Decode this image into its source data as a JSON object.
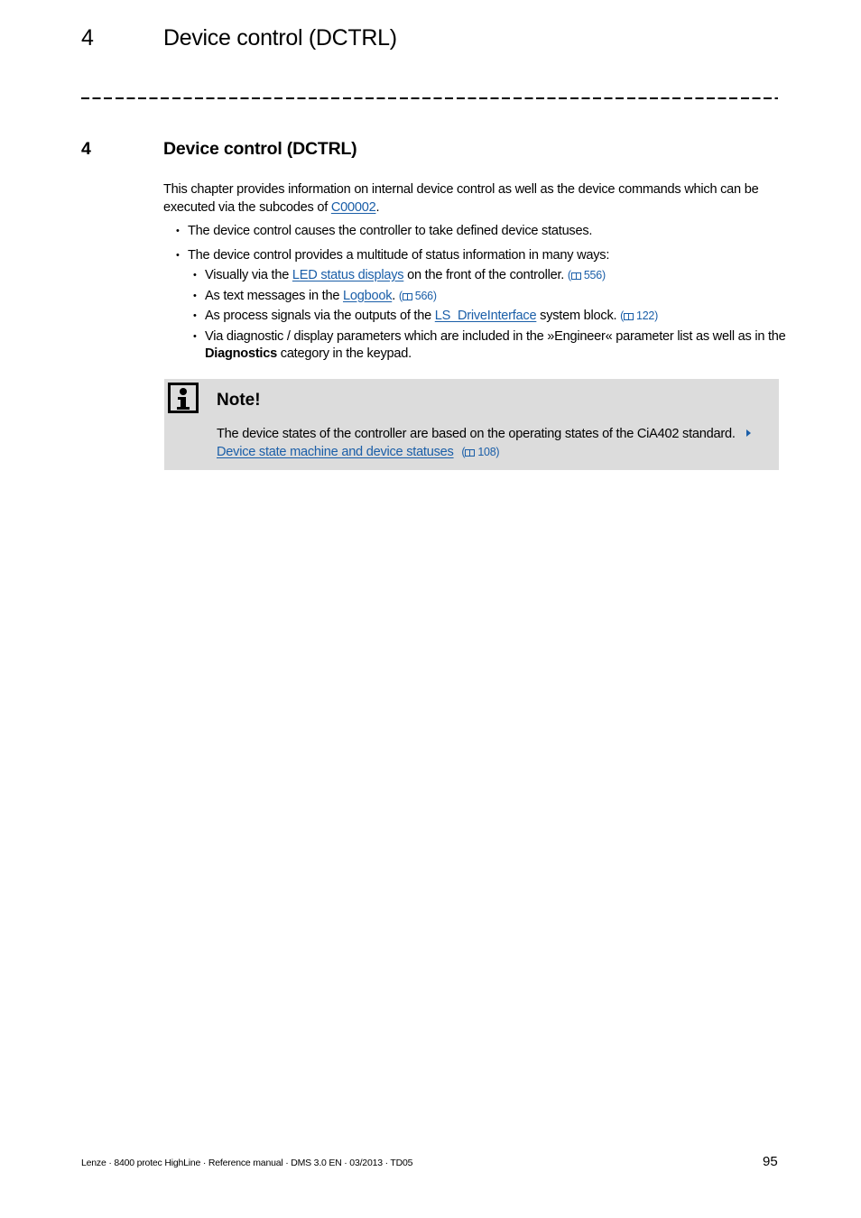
{
  "running_header": {
    "number": "4",
    "title": "Device control (DCTRL)"
  },
  "chapter": {
    "number": "4",
    "title": "Device control (DCTRL)"
  },
  "intro": {
    "text_before": "This chapter provides information on internal device control as well as the device commands which can be executed via the subcodes of ",
    "link": "C00002",
    "text_after": "."
  },
  "bullets": [
    {
      "text": "The device control causes the controller to take defined device statuses."
    },
    {
      "text": "The device control provides a multitude of status information in many ways:"
    }
  ],
  "sub_bullets": [
    {
      "before": "Visually via the ",
      "link": "LED status displays",
      "after": " on the front of the controller. ",
      "ref": "556"
    },
    {
      "before": "As text messages in the ",
      "link": "Logbook",
      "after": ". ",
      "ref": "566"
    },
    {
      "before": "As process signals via the outputs of the ",
      "link": "LS_DriveInterface",
      "after": " system block. ",
      "ref": "122"
    },
    {
      "before": "Via diagnostic / display parameters which are included in the »Engineer« parameter list as well as in the ",
      "bold": "Diagnostics",
      "after": " category in the keypad."
    }
  ],
  "note": {
    "icon": "info-icon",
    "title": "Note!",
    "text": "The device states of the controller are based on the operating states of the CiA402 standard.",
    "link": "Device state machine and device statuses",
    "ref": "108"
  },
  "footer": {
    "text": "Lenze · 8400 protec HighLine · Reference manual · DMS 3.0 EN · 03/2013 · TD05",
    "page_number": "95"
  },
  "colors": {
    "link": "#1a5ea8",
    "note_bg": "#dcdcdc"
  }
}
